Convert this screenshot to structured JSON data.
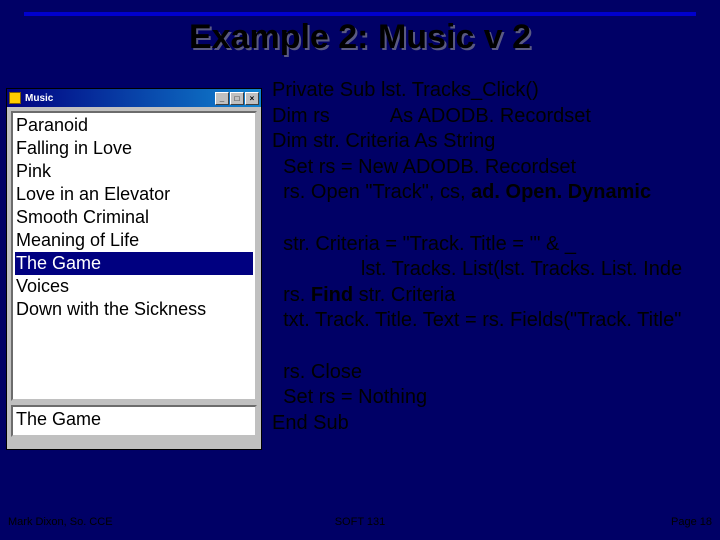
{
  "title": "Example 2: Music v 2",
  "window": {
    "caption": "Music",
    "btn_min": "_",
    "btn_max": "□",
    "btn_close": "×",
    "list": {
      "items": [
        "Paranoid",
        "Falling in Love",
        "Pink",
        "Love in an Elevator",
        "Smooth Criminal",
        "Meaning of Life",
        "The Game",
        "Voices",
        "Down with the Sickness"
      ],
      "selected_index": 6
    },
    "textbox_value": "The Game"
  },
  "code": {
    "l1": "Private Sub lst. Tracks_Click()",
    "l2a": "Dim rs",
    "l2b": "As ADODB. Recordset",
    "l3": "Dim str. Criteria As String",
    "l4": "  Set rs = New ADODB. Recordset",
    "l5a": "  rs. Open \"Track\", cs, ",
    "l5b": "ad. Open. Dynamic",
    "l6": "",
    "l7": "  str. Criteria = \"Track. Title = '\" & _",
    "l8": "                lst. Tracks. List(lst. Tracks. List. Inde",
    "l9a": "  rs. ",
    "l9b": "Find",
    "l9c": " str. Criteria",
    "l10": "  txt. Track. Title. Text = rs. Fields(\"Track. Title\"",
    "l11": "",
    "l12": "  rs. Close",
    "l13": "  Set rs = Nothing",
    "l14": "End Sub"
  },
  "footer": {
    "left": "Mark Dixon, So. CCE",
    "center": "SOFT 131",
    "right": "Page 18"
  }
}
